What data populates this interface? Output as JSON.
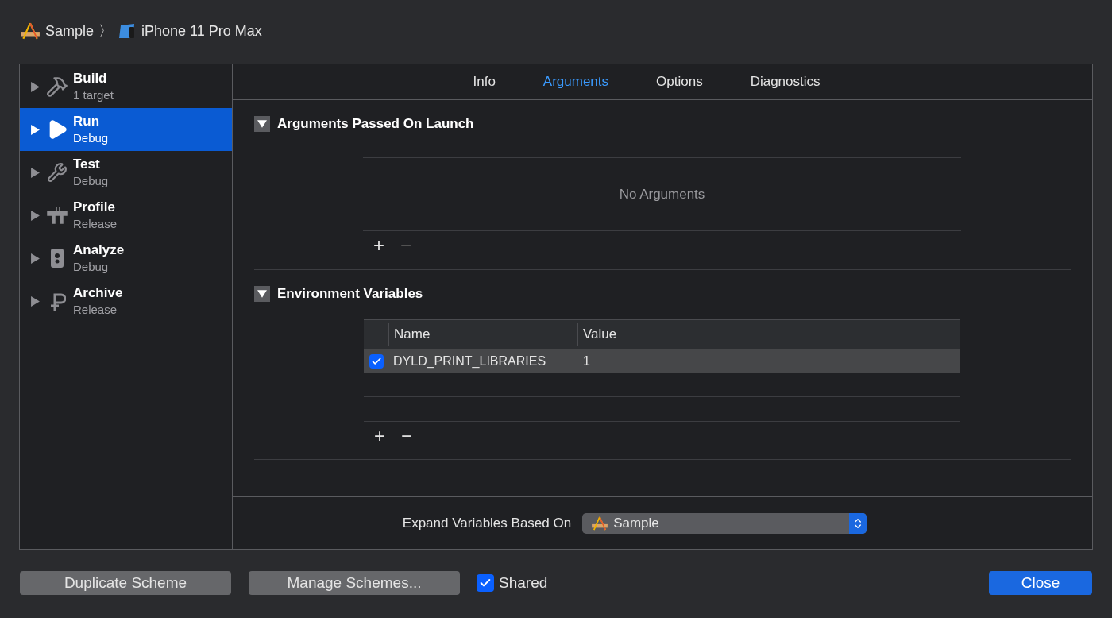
{
  "breadcrumb": {
    "project": "Sample",
    "separator": "〉",
    "device": "iPhone 11 Pro Max"
  },
  "sidebar": {
    "items": [
      {
        "title": "Build",
        "subtitle": "1 target",
        "selected": false
      },
      {
        "title": "Run",
        "subtitle": "Debug",
        "selected": true
      },
      {
        "title": "Test",
        "subtitle": "Debug",
        "selected": false
      },
      {
        "title": "Profile",
        "subtitle": "Release",
        "selected": false
      },
      {
        "title": "Analyze",
        "subtitle": "Debug",
        "selected": false
      },
      {
        "title": "Archive",
        "subtitle": "Release",
        "selected": false
      }
    ]
  },
  "tabs": [
    {
      "label": "Info",
      "selected": false
    },
    {
      "label": "Arguments",
      "selected": true
    },
    {
      "label": "Options",
      "selected": false
    },
    {
      "label": "Diagnostics",
      "selected": false
    }
  ],
  "arguments_section": {
    "title": "Arguments Passed On Launch",
    "expanded": true,
    "empty_text": "No Arguments",
    "add": {
      "label": "+",
      "disabled": false
    },
    "remove": {
      "label": "−",
      "disabled": true
    }
  },
  "environment_section": {
    "title": "Environment Variables",
    "expanded": true,
    "columns": [
      "Name",
      "Value"
    ],
    "rows": [
      {
        "checked": true,
        "name": "DYLD_PRINT_LIBRARIES",
        "value": "1",
        "selected": true
      }
    ],
    "add": {
      "label": "+",
      "disabled": false
    },
    "remove": {
      "label": "−",
      "disabled": false
    }
  },
  "expand_variables": {
    "label": "Expand Variables Based On",
    "value": "Sample"
  },
  "footer": {
    "duplicate": "Duplicate Scheme",
    "manage": "Manage Schemes...",
    "shared": {
      "label": "Shared",
      "checked": true
    },
    "close": "Close"
  }
}
